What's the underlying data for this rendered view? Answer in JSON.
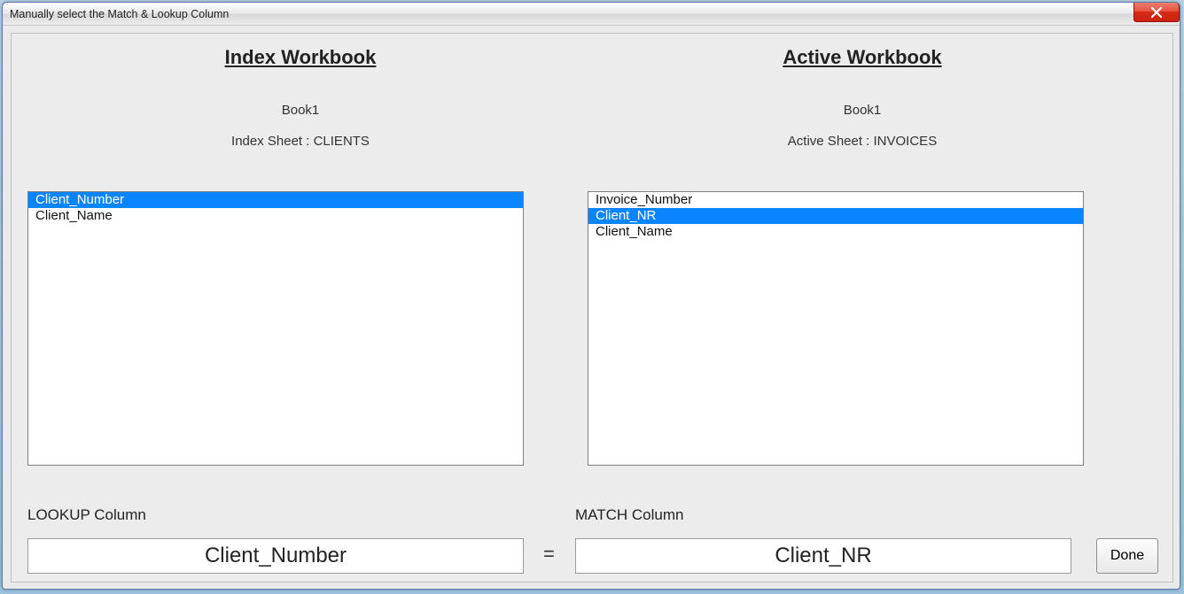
{
  "title": "Manually select the Match & Lookup Column",
  "index_panel": {
    "heading": "Index Workbook",
    "workbook": "Book1",
    "sheet_label": "Index Sheet : CLIENTS",
    "columns": [
      {
        "label": "Client_Number",
        "selected": true
      },
      {
        "label": "Client_Name",
        "selected": false
      }
    ]
  },
  "active_panel": {
    "heading": "Active Workbook",
    "workbook": "Book1",
    "sheet_label": "Active Sheet : INVOICES",
    "columns": [
      {
        "label": "Invoice_Number",
        "selected": false
      },
      {
        "label": "Client_NR",
        "selected": true
      },
      {
        "label": "Client_Name",
        "selected": false
      }
    ]
  },
  "lookup_label": "LOOKUP Column",
  "match_label": "MATCH Column",
  "lookup_value": "Client_Number",
  "match_value": "Client_NR",
  "equals": "=",
  "done_label": "Done"
}
